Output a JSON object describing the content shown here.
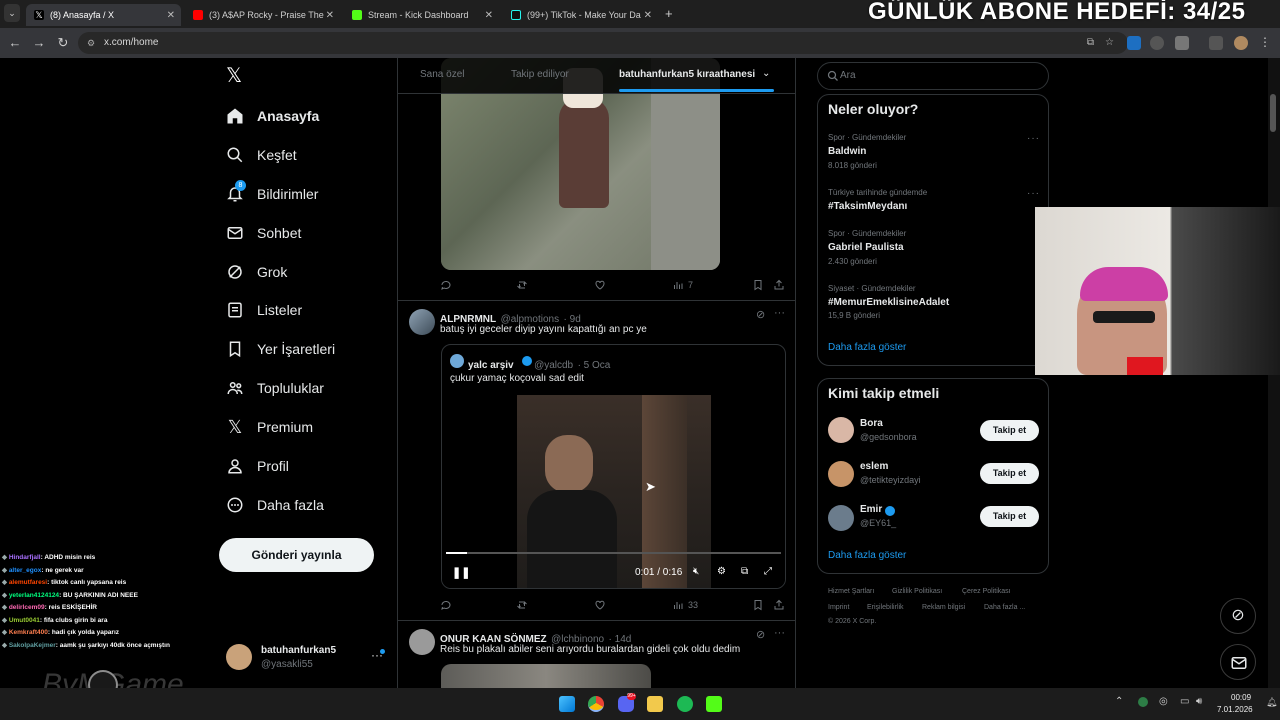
{
  "overlay": {
    "goal_text": "GÜNLÜK ABONE HEDEFİ: 34/25",
    "watermark": "ByMGame"
  },
  "browser": {
    "tabs": [
      {
        "title": "(8) Anasayfa / X",
        "icon": "x-logo-icon",
        "active": true
      },
      {
        "title": "(3) A$AP Rocky - Praise The",
        "icon": "youtube-icon",
        "active": false
      },
      {
        "title": "Stream - Kick Dashboard",
        "icon": "kick-icon",
        "active": false
      },
      {
        "title": "(99+) TikTok - Make Your Da",
        "icon": "tiktok-icon",
        "active": false
      }
    ],
    "url": "x.com/home"
  },
  "nav": {
    "notification_badge": "8",
    "items": [
      {
        "label": "Anasayfa",
        "icon": "home-icon",
        "active": true
      },
      {
        "label": "Keşfet",
        "icon": "search-icon"
      },
      {
        "label": "Bildirimler",
        "icon": "bell-icon"
      },
      {
        "label": "Sohbet",
        "icon": "mail-icon"
      },
      {
        "label": "Grok",
        "icon": "grok-icon"
      },
      {
        "label": "Listeler",
        "icon": "list-icon"
      },
      {
        "label": "Yer İşaretleri",
        "icon": "bookmark-icon"
      },
      {
        "label": "Topluluklar",
        "icon": "communities-icon"
      },
      {
        "label": "Premium",
        "icon": "x-logo-icon"
      },
      {
        "label": "Profil",
        "icon": "person-icon"
      },
      {
        "label": "Daha fazla",
        "icon": "more-circle-icon"
      }
    ],
    "post_button": "Gönderi yayınla",
    "account": {
      "name": "batuhanfurkan5",
      "handle": "@yasakli55"
    }
  },
  "timeline": {
    "tabs": [
      "Sana özel",
      "Takip ediliyor",
      "batuhanfurkan5 kıraathanesi"
    ],
    "first_tweet_actions": {
      "views": "7"
    },
    "tweet1": {
      "name": "ALPNRMNL",
      "handle": "@alpmotions",
      "time": "· 9d",
      "text": "batuş iyi geceler diyip yayını kapattığı an pc ye",
      "quote": {
        "name": "yalc arşiv",
        "handle": "@yalcdb",
        "time": "· 5 Oca",
        "text": "çukur yamaç koçovalı sad edit"
      },
      "video_time": "0:01 / 0:16",
      "video_progress": 0.0625,
      "views": "33"
    },
    "tweet2": {
      "name": "ONUR KAAN SÖNMEZ",
      "handle": "@lchbinono",
      "time": "· 14d",
      "text": "Reis bu plakalı abiler seni arıyordu buralardan gideli çok oldu dedim"
    }
  },
  "right": {
    "search_placeholder": "Ara",
    "trends_title": "Neler oluyor?",
    "trends": [
      {
        "meta": "Spor · Gündemdekiler",
        "name": "Baldwin",
        "count": "8.018 gönderi"
      },
      {
        "meta": "Türkiye tarihinde gündemde",
        "name": "#TaksimMeydanı",
        "count": ""
      },
      {
        "meta": "Spor · Gündemdekiler",
        "name": "Gabriel Paulista",
        "count": "2.430 gönderi"
      },
      {
        "meta": "Siyaset · Gündemdekiler",
        "name": "#MemurEmeklisineAdalet",
        "count": "15,9 B gönderi"
      }
    ],
    "show_more": "Daha fazla göster",
    "who_title": "Kimi takip etmeli",
    "who": [
      {
        "name": "Bora",
        "handle": "@gedsonbora",
        "verified": false
      },
      {
        "name": "eslem",
        "handle": "@tetikteyizdayi",
        "verified": false
      },
      {
        "name": "Emir",
        "handle": "@EY61_",
        "verified": true
      }
    ],
    "follow_label": "Takip et",
    "who_show_more": "Daha fazla göster",
    "footer": [
      "Hizmet Şartları",
      "Gizlilik Politikası",
      "Çerez Politikası",
      "Imprint",
      "Erişilebilirlik",
      "Reklam bilgisi",
      "Daha fazla ...",
      "© 2026 X Corp."
    ]
  },
  "chat": [
    {
      "user": "Hindarfjall",
      "msg": ": ADHD misin reis",
      "color": "#a970ff"
    },
    {
      "user": "alter_egox",
      "msg": ": ne gerek var",
      "color": "#1e90ff"
    },
    {
      "user": "alemutfaresi",
      "msg": ": tiktok canlı yapsana reis",
      "color": "#ff4500"
    },
    {
      "user": "yeterlan4124124",
      "msg": ": BU ŞARKININ ADI NEEE",
      "color": "#00ff7f"
    },
    {
      "user": "delirlcem09",
      "msg": ": reis ESKİŞEHİR",
      "color": "#ff69b4"
    },
    {
      "user": "Umut0041",
      "msg": ": fifa clubs girin bi ara",
      "color": "#9acd32"
    },
    {
      "user": "Kemkraft400",
      "msg": ": hadi çık yolda yaparız",
      "color": "#ff7f50"
    },
    {
      "user": "SakolpaKejmer",
      "msg": ": aamk şu şarkıyı 40dk önce açmıştın",
      "color": "#5f9ea0"
    }
  ],
  "taskbar": {
    "time": "00:09",
    "date": "7.01.2026"
  }
}
